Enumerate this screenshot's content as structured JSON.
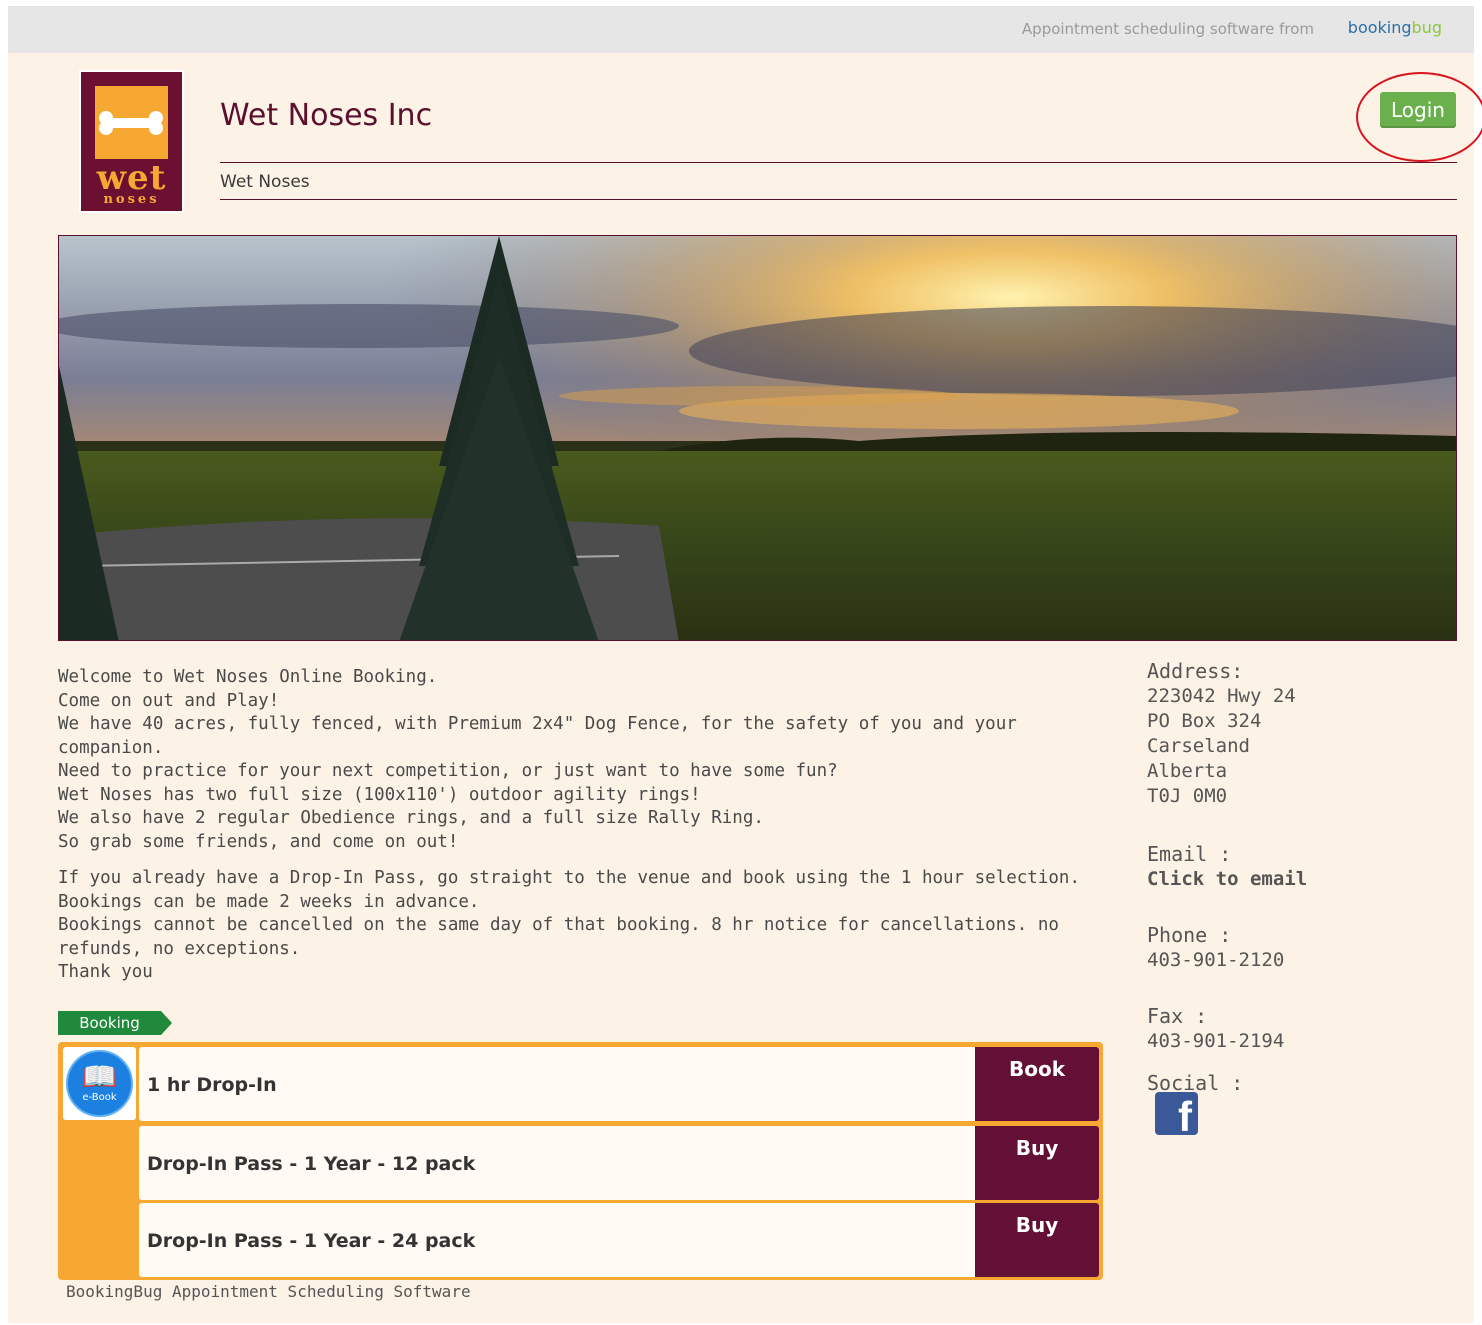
{
  "topbar": {
    "tagline": "Appointment scheduling software from",
    "brand_main": "booking",
    "brand_accent": "bug"
  },
  "logo": {
    "word1": "wet",
    "word2": "noses"
  },
  "header": {
    "title": "Wet Noses Inc",
    "subtitle": "Wet Noses",
    "login_label": "Login"
  },
  "description": {
    "paragraph1": [
      "Welcome to Wet Noses Online Booking.",
      "Come on out and Play!",
      "We have 40 acres, fully fenced, with Premium 2x4\" Dog Fence, for the safety of you and your companion.",
      "Need to practice for your next competition, or just want to have some fun?",
      "Wet Noses has two full size (100x110') outdoor agility rings!",
      "We also have 2 regular Obedience rings, and a full size Rally Ring.",
      "So grab some friends, and come on out!"
    ],
    "paragraph2": [
      "If you already have a Drop-In Pass, go straight to the venue and book using the 1 hour selection.",
      "Bookings can be made 2 weeks in advance.",
      "Bookings cannot be cancelled on the same day of that booking. 8 hr notice for cancellations. no refunds, no exceptions.",
      "Thank you"
    ]
  },
  "contact": {
    "address_label": "Address:",
    "address_lines": [
      "223042 Hwy 24",
      "PO Box 324",
      "Carseland",
      "Alberta",
      "T0J 0M0"
    ],
    "email_label": "Email :",
    "email_link": "Click to email",
    "phone_label": "Phone :",
    "phone": "403-901-2120",
    "fax_label": "Fax :",
    "fax": "403-901-2194",
    "social_label": "Social :"
  },
  "booking": {
    "tag": "Booking",
    "icon_text": "e-Book",
    "items": [
      {
        "title": "1 hr Drop-In",
        "action": "Book"
      },
      {
        "title": "Drop-In Pass - 1 Year - 12 pack",
        "action": "Buy"
      },
      {
        "title": "Drop-In Pass - 1 Year - 24 pack",
        "action": "Buy"
      }
    ]
  },
  "footer": {
    "text": "BookingBug Appointment Scheduling Software"
  },
  "colors": {
    "brand": "#5a0f2e",
    "accent": "#f6a832",
    "login_green": "#6ab04c",
    "booking_green": "#1f8a3c",
    "page_bg": "#fdf2e6"
  }
}
